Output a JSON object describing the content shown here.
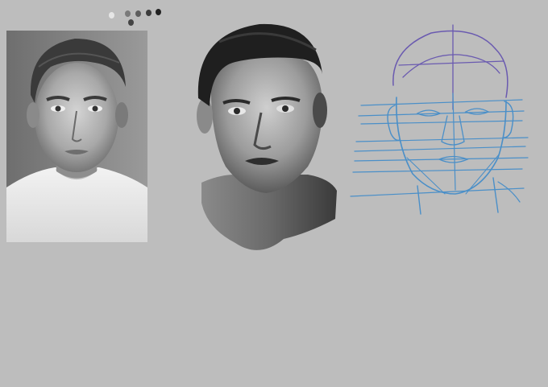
{
  "canvas": {
    "background": "#bdbdbd"
  },
  "palette": {
    "colors": [
      "#e6e6e6",
      "#7a7a7a",
      "#5e5e5e",
      "#3c3c3c",
      "#9a9a9a",
      "#222222",
      "#444444"
    ]
  },
  "artwork": {
    "reference_photo": "grayscale-portrait-photo",
    "painted_study": "grayscale-painted-portrait",
    "construction_sketch": "line-construction-sketch"
  },
  "colors": {
    "sketch_primary": "#4a8fc8",
    "sketch_secondary": "#6a5ab0"
  }
}
